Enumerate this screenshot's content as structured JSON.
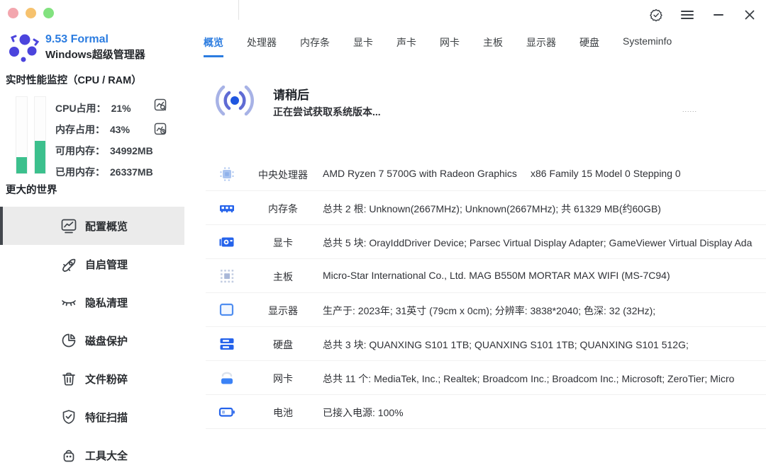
{
  "window": {
    "traffic_lights": [
      "#f3a6ae",
      "#f6c26e",
      "#82e27f"
    ],
    "controls": {
      "certified_icon": "seal-check",
      "menu_icon": "hamburger",
      "minimize_icon": "minus",
      "close_icon": "close"
    }
  },
  "app": {
    "version": "9.53 Formal",
    "name": "Windows超级管理器"
  },
  "sidebar": {
    "monitor_title": "实时性能监控（CPU / RAM）",
    "stats": [
      {
        "label": "CPU占用：",
        "value": "21%"
      },
      {
        "label": "内存占用：",
        "value": "43%"
      },
      {
        "label": "可用内存：",
        "value": "34992MB"
      },
      {
        "label": "已用内存：",
        "value": "26337MB"
      }
    ],
    "bars": {
      "cpu_percent": 21,
      "ram_percent": 43,
      "fill_color": "#3cc08d"
    },
    "section_title": "更大的世界",
    "menu": [
      {
        "label": "配置概览",
        "icon": "chart-monitor",
        "active": true
      },
      {
        "label": "自启管理",
        "icon": "rocket",
        "active": false
      },
      {
        "label": "隐私清理",
        "icon": "closed-eye",
        "active": false
      },
      {
        "label": "磁盘保护",
        "icon": "pie-chart",
        "active": false
      },
      {
        "label": "文件粉碎",
        "icon": "trash",
        "active": false
      },
      {
        "label": "特征扫描",
        "icon": "shield-check",
        "active": false
      },
      {
        "label": "工具大全",
        "icon": "bag",
        "active": false
      }
    ]
  },
  "tabs": [
    {
      "label": "概览",
      "active": true
    },
    {
      "label": "处理器",
      "active": false
    },
    {
      "label": "内存条",
      "active": false
    },
    {
      "label": "显卡",
      "active": false
    },
    {
      "label": "声卡",
      "active": false
    },
    {
      "label": "网卡",
      "active": false
    },
    {
      "label": "主板",
      "active": false
    },
    {
      "label": "显示器",
      "active": false
    },
    {
      "label": "硬盘",
      "active": false
    },
    {
      "label": "Systeminfo",
      "active": false
    }
  ],
  "loading": {
    "title": "请稍后",
    "subtitle": "正在尝试获取系统版本...",
    "dots": "......"
  },
  "table": {
    "rows": [
      {
        "icon": "cpu",
        "label": "中央处理器",
        "value": "AMD Ryzen 7 5700G with Radeon Graphics",
        "extra": "x86 Family 15 Model 0 Stepping 0"
      },
      {
        "icon": "ram",
        "label": "内存条",
        "value": "总共 2 根: Unknown(2667MHz); Unknown(2667MHz); 共 61329 MB(约60GB)",
        "extra": ""
      },
      {
        "icon": "gpu",
        "label": "显卡",
        "value": "总共 5 块: OrayIddDriver Device; Parsec Virtual Display Adapter; GameViewer Virtual Display Ada",
        "extra": ""
      },
      {
        "icon": "motherboard",
        "label": "主板",
        "value": "Micro-Star International Co., Ltd.  MAG B550M MORTAR MAX WIFI (MS-7C94)",
        "extra": ""
      },
      {
        "icon": "monitor",
        "label": "显示器",
        "value": "生产于: 2023年; 31英寸 (79cm x 0cm); 分辨率: 3838*2040; 色深: 32 (32Hz);",
        "extra": ""
      },
      {
        "icon": "disk",
        "label": "硬盘",
        "value": "总共 3 块: QUANXING S101 1TB; QUANXING S101 1TB; QUANXING S101 512G;",
        "extra": ""
      },
      {
        "icon": "network",
        "label": "网卡",
        "value": "总共 11 个: MediaTek, Inc.; Realtek; Broadcom Inc.; Broadcom Inc.; Microsoft; ZeroTier; Micro",
        "extra": ""
      },
      {
        "icon": "battery",
        "label": "电池",
        "value": "已接入电源: 100%",
        "extra": ""
      }
    ]
  }
}
